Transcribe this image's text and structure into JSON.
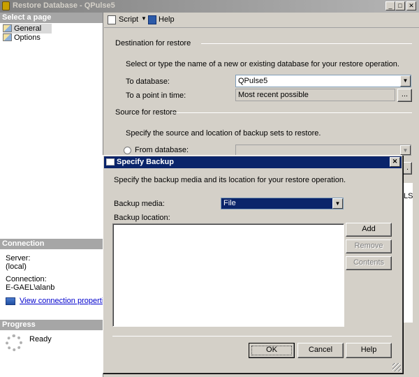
{
  "window": {
    "title": "Restore Database - QPulse5"
  },
  "left_pane": {
    "select_page_header": "Select a page",
    "pages": [
      {
        "label": "General"
      },
      {
        "label": "Options"
      }
    ],
    "connection_header": "Connection",
    "server_label": "Server:",
    "server_value": "(local)",
    "connection_label": "Connection:",
    "connection_value": "E-GAEL\\alanb",
    "view_props_link": "View connection properties",
    "progress_header": "Progress",
    "progress_status": "Ready"
  },
  "toolbar": {
    "script_label": "Script",
    "help_label": "Help"
  },
  "general": {
    "destination_group": "Destination for restore",
    "destination_desc": "Select or type the name of a new or existing database for your restore operation.",
    "to_database_label": "To database:",
    "to_database_value": "QPulse5",
    "point_in_time_label": "To a point in time:",
    "point_in_time_value": "Most recent possible",
    "browse_label": "...",
    "source_group": "Source for restore",
    "source_desc": "Specify the source and location of backup sets to restore.",
    "from_database_label": "From database:",
    "partial_label": "LSI"
  },
  "dialog": {
    "title": "Specify Backup",
    "description": "Specify the backup media and its location for your restore operation.",
    "backup_media_label": "Backup media:",
    "backup_media_value": "File",
    "backup_location_label": "Backup location:",
    "add_label": "Add",
    "remove_label": "Remove",
    "contents_label": "Contents",
    "ok_label": "OK",
    "cancel_label": "Cancel",
    "help_label": "Help"
  }
}
